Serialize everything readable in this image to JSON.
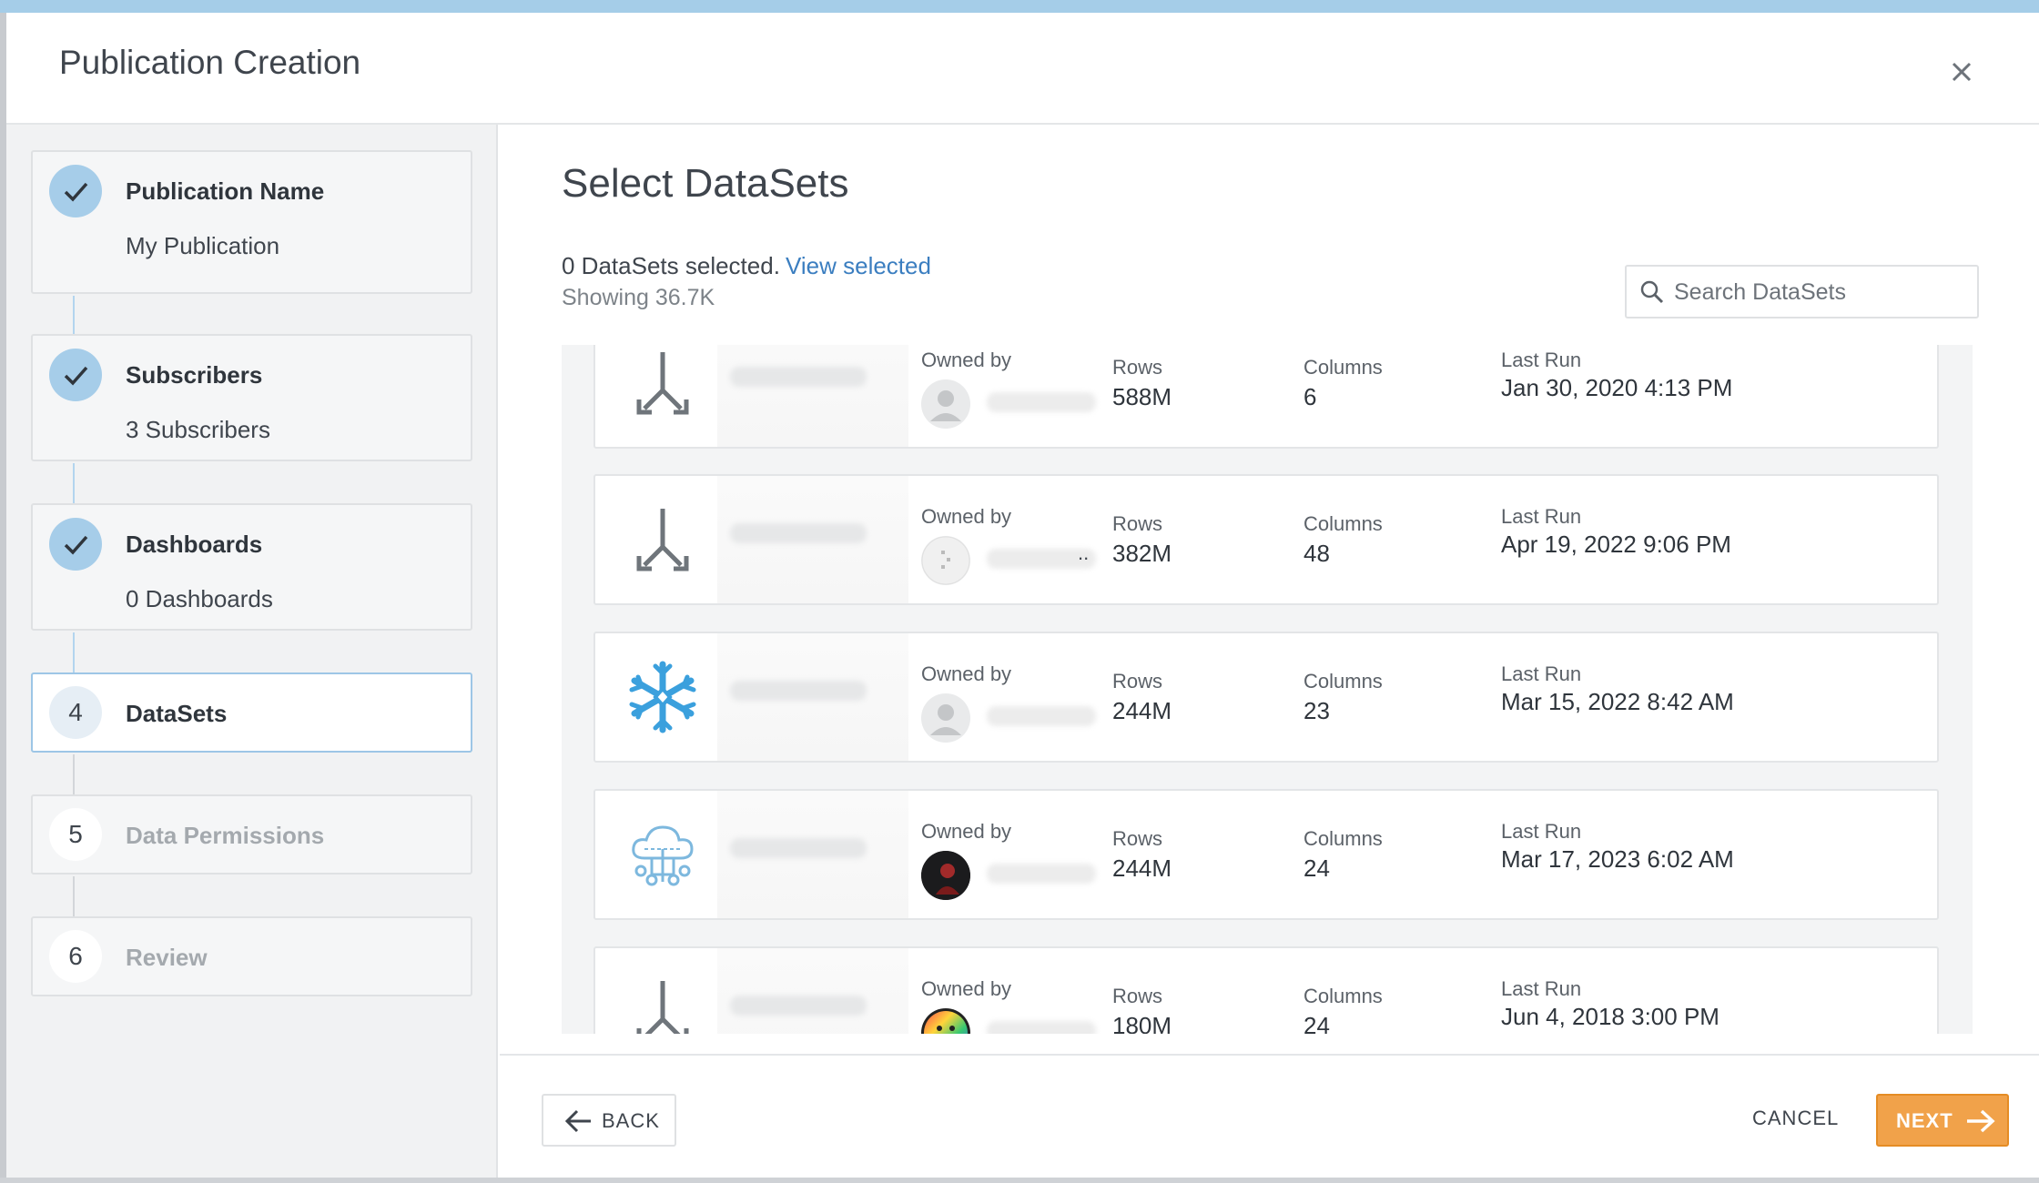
{
  "modal": {
    "title": "Publication Creation"
  },
  "steps": [
    {
      "number": "1",
      "title": "Publication Name",
      "subtitle": "My Publication",
      "state": "done"
    },
    {
      "number": "2",
      "title": "Subscribers",
      "subtitle": "3 Subscribers",
      "state": "done"
    },
    {
      "number": "3",
      "title": "Dashboards",
      "subtitle": "0 Dashboards",
      "state": "done"
    },
    {
      "number": "4",
      "title": "DataSets",
      "subtitle": "",
      "state": "active"
    },
    {
      "number": "5",
      "title": "Data Permissions",
      "subtitle": "",
      "state": "pending"
    },
    {
      "number": "6",
      "title": "Review",
      "subtitle": "",
      "state": "pending"
    }
  ],
  "main": {
    "title": "Select DataSets",
    "selected_count": "0 DataSets selected.",
    "view_selected": "View selected",
    "showing": "Showing 36.7K",
    "search_placeholder": "Search DataSets"
  },
  "labels": {
    "owned_by": "Owned by",
    "rows": "Rows",
    "columns": "Columns",
    "last_run": "Last Run"
  },
  "datasets": [
    {
      "icon": "dataflow-icon",
      "rows": "588M",
      "columns": "6",
      "last_run": "Jan 30, 2020 4:13 PM",
      "avatar": "default-avatar"
    },
    {
      "icon": "dataflow-icon",
      "rows": "382M",
      "columns": "48",
      "last_run": "Apr 19, 2022 9:06 PM",
      "avatar": "default-avatar",
      "owner_suffix": ".."
    },
    {
      "icon": "snowflake-icon",
      "rows": "244M",
      "columns": "23",
      "last_run": "Mar 15, 2022 8:42 AM",
      "avatar": "default-avatar"
    },
    {
      "icon": "cloud-connector-icon",
      "rows": "244M",
      "columns": "24",
      "last_run": "Mar 17, 2023 6:02 AM",
      "avatar": "photo-avatar"
    },
    {
      "icon": "dataflow-icon",
      "rows": "180M",
      "columns": "24",
      "last_run": "Jun 4, 2018 3:00 PM",
      "avatar": "smiley-avatar"
    }
  ],
  "footer": {
    "back": "BACK",
    "cancel": "CANCEL",
    "next": "NEXT"
  },
  "colors": {
    "accent": "#a6cde9",
    "link": "#3b7ec0",
    "primary_button": "#f1a24a",
    "snowflake": "#3ba0dd"
  }
}
